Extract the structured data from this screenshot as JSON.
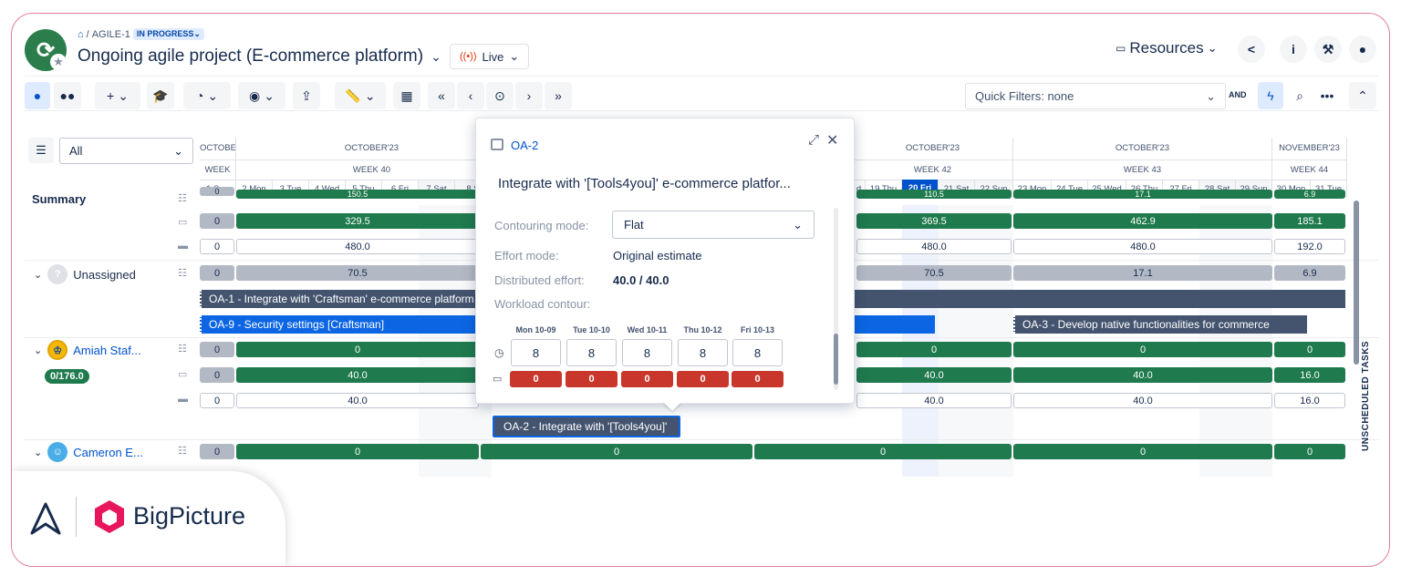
{
  "header": {
    "breadcrumb_project": "AGILE-1",
    "status": "IN PROGRESS",
    "title": "Ongoing agile project (E-commerce platform)",
    "live_label": "Live",
    "resources_label": "Resources"
  },
  "toolbar": {
    "quick_filters": "Quick Filters: none",
    "and_label": "AND"
  },
  "left_panel": {
    "filter_value": "All",
    "summary_label": "Summary",
    "unassigned_label": "Unassigned",
    "amiah_label": "Amiah Staf...",
    "amiah_capacity": "0/176.0",
    "cameron_label": "Cameron E..."
  },
  "calendar": {
    "months": [
      "OCTOBE",
      "OCTOBER'23",
      "OCTOBER'23",
      "OCTOBER'23",
      "NOVEMBER'23"
    ],
    "weeks": [
      "WEEK",
      "WEEK 40",
      "WEEK 42",
      "WEEK 43",
      "WEEK 44"
    ],
    "days": [
      "1 Sun",
      "2 Mon",
      "3 Tue",
      "4 Wed",
      "5 Thu",
      "6 Fri",
      "7 Sat",
      "8 S",
      "d",
      "19 Thu",
      "20 Fri",
      "21 Sat",
      "22 Sun",
      "23 Mon",
      "24 Tue",
      "25 Wed",
      "26 Thu",
      "27 Fri",
      "28 Sat",
      "29 Sun",
      "30 Mon",
      "31 Tue"
    ]
  },
  "rows": {
    "summary": {
      "top": [
        "329.5",
        "369.5",
        "462.9",
        "185.1"
      ],
      "partial_top": [
        "150.5",
        "110.5",
        "17.1",
        "6.9"
      ],
      "lead": [
        "0",
        "0"
      ],
      "bottom": [
        "480.0",
        "480.0",
        "480.0",
        "192.0"
      ]
    },
    "unassigned": {
      "lead": "0",
      "vals": [
        "70.5",
        "70.5",
        "17.1",
        "6.9"
      ]
    },
    "tasks": {
      "oa1": "OA-1 - Integrate with 'Craftsman' e-commerce platform",
      "oa9": "OA-9 - Security settings [Craftsman]",
      "oa3": "OA-3 - Develop native functionalities for commerce",
      "oa2": "OA-2 - Integrate with '[Tools4you]'"
    },
    "amiah": {
      "lead": [
        "0",
        "0",
        "0"
      ],
      "r1": [
        "0",
        "0",
        "0",
        "0"
      ],
      "r2": [
        "40.0",
        "40.0",
        "40.0",
        "16.0"
      ],
      "r3": [
        "40.0",
        "40.0",
        "40.0",
        "40.0",
        "16.0"
      ]
    },
    "cameron": {
      "lead": "0",
      "vals": [
        "0",
        "0",
        "0",
        "0",
        "0"
      ]
    }
  },
  "popup": {
    "key": "OA-2",
    "summary": "Integrate with '[Tools4you]' e-commerce platfor...",
    "contouring_label": "Contouring mode:",
    "contouring_value": "Flat",
    "effort_mode_label": "Effort mode:",
    "effort_mode_value": "Original estimate",
    "distributed_label": "Distributed effort:",
    "distributed_value": "40.0 / 40.0",
    "workload_label": "Workload contour:",
    "days": [
      {
        "label": "Mon 10-09",
        "hours": "8",
        "red": "0"
      },
      {
        "label": "Tue 10-10",
        "hours": "8",
        "red": "0"
      },
      {
        "label": "Wed 10-11",
        "hours": "8",
        "red": "0"
      },
      {
        "label": "Thu 10-12",
        "hours": "8",
        "red": "0"
      },
      {
        "label": "Fri 10-13",
        "hours": "8",
        "red": "0"
      }
    ]
  },
  "side": {
    "unscheduled": "UNSCHEDULED TASKS"
  },
  "brand": {
    "name": "BigPicture"
  }
}
